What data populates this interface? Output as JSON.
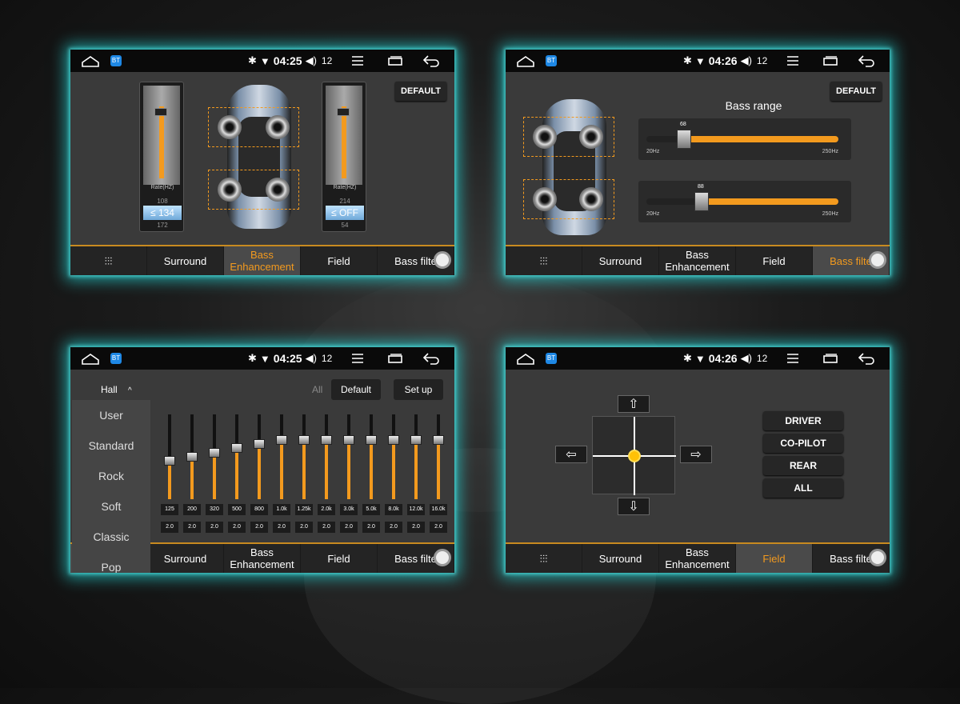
{
  "status": {
    "time_a": "04:25",
    "time_b": "04:26",
    "volume": "12",
    "app_badge": "BT"
  },
  "tabs": {
    "surround": "Surround",
    "bass_enh": "Bass\nEnhancement",
    "field": "Field",
    "bass_filter": "Bass filte"
  },
  "default_label": "DEFAULT",
  "panel1": {
    "left_module": {
      "ticks": [
        "12",
        "12",
        "9",
        "6",
        "3",
        "0"
      ],
      "rate_label": "Rate(HZ)",
      "prev": "108",
      "value": "134",
      "next": "172"
    },
    "right_module": {
      "ticks": [
        "12",
        "12",
        "9",
        "6",
        "3",
        "0"
      ],
      "rate_label": "Rate(HZ)",
      "prev": "214",
      "value": "OFF",
      "next": "54"
    }
  },
  "panel2": {
    "title": "Bass range",
    "slider1": {
      "value": "68",
      "min": "20Hz",
      "max": "250Hz"
    },
    "slider2": {
      "value": "88",
      "min": "20Hz",
      "max": "250Hz"
    }
  },
  "panel3": {
    "preset": "Hall",
    "presets": [
      "User",
      "Standard",
      "Rock",
      "Soft",
      "Classic",
      "Pop"
    ],
    "all_label": "All",
    "default_btn": "Default",
    "setup_btn": "Set up",
    "freqs": [
      "125",
      "200",
      "320",
      "500",
      "800",
      "1.0k",
      "1.25k",
      "2.0k",
      "3.0k",
      "5.0k",
      "8.0k",
      "12.0k",
      "16.0k"
    ],
    "q_values": [
      "2.0",
      "2.0",
      "2.0",
      "2.0",
      "2.0",
      "2.0",
      "2.0",
      "2.0",
      "2.0",
      "2.0",
      "2.0",
      "2.0",
      "2.0"
    ],
    "levels": [
      0.45,
      0.5,
      0.55,
      0.6,
      0.65,
      0.7,
      0.7,
      0.7,
      0.7,
      0.7,
      0.7,
      0.7,
      0.7
    ]
  },
  "panel4": {
    "seats": [
      "DRIVER",
      "CO-PILOT",
      "REAR",
      "ALL"
    ],
    "arrows": {
      "up": "⇧",
      "down": "⇩",
      "left": "⇦",
      "right": "⇨"
    }
  },
  "colors": {
    "accent": "#f39a1e",
    "glow": "#28e6e6"
  }
}
